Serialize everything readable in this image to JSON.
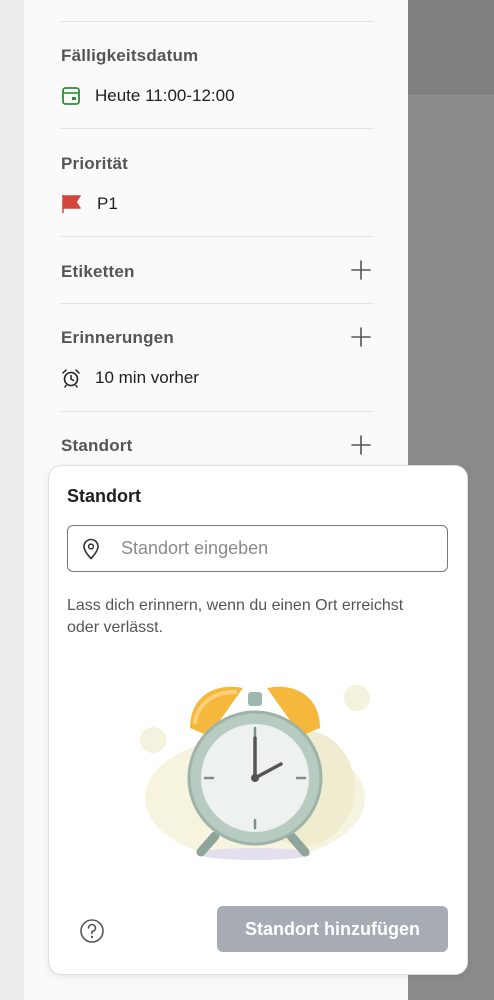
{
  "task_details": {
    "due_date": {
      "label": "Fälligkeitsdatum",
      "value": "Heute 11:00-12:00",
      "icon": "calendar-icon",
      "color": "#2e8b3a"
    },
    "priority": {
      "label": "Priorität",
      "value": "P1",
      "icon": "flag-icon",
      "color": "#d1453b"
    },
    "labels": {
      "label": "Etiketten",
      "add_icon": "plus-icon"
    },
    "reminders": {
      "label": "Erinnerungen",
      "value": "10 min vorher",
      "icon": "alarm-icon",
      "add_icon": "plus-icon"
    },
    "location": {
      "label": "Standort",
      "add_icon": "plus-icon"
    }
  },
  "location_sheet": {
    "title": "Standort",
    "input": {
      "placeholder": "Standort eingeben",
      "value": "",
      "icon": "location-pin-icon"
    },
    "description": "Lass dich erinnern, wenn du einen Ort erreichst oder verlässt.",
    "illustration": "alarm-clock-illustration",
    "help_icon": "help-icon",
    "add_button": "Standort hinzufügen",
    "add_button_color": "#a7acb4"
  }
}
